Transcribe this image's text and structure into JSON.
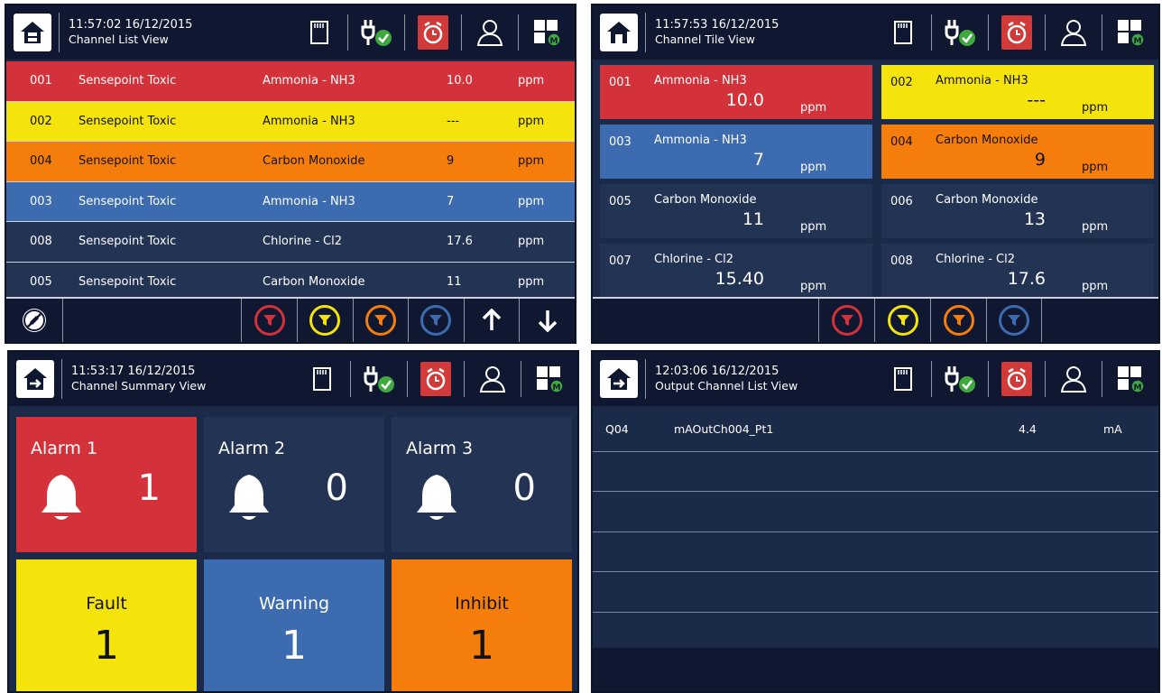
{
  "colors": {
    "red": "#d4323a",
    "yellow": "#f4e40c",
    "orange": "#f57d0c",
    "blue": "#3d6bb0",
    "navy": "#223353",
    "dark": "#0f1830"
  },
  "icons": [
    "home-icon",
    "sd-card-icon",
    "power-ok-icon",
    "alarm-clock-icon",
    "user-icon",
    "grid-menu-icon"
  ],
  "panel1": {
    "time": "11:57:02  16/12/2015",
    "view": "Channel List View",
    "rows": [
      {
        "id": "001",
        "name": "Sensepoint Toxic",
        "gas": "Ammonia - NH3",
        "value": "10.0",
        "unit": "ppm"
      },
      {
        "id": "002",
        "name": "Sensepoint Toxic",
        "gas": "Ammonia - NH3",
        "value": "---",
        "unit": "ppm"
      },
      {
        "id": "004",
        "name": "Sensepoint Toxic",
        "gas": "Carbon Monoxide",
        "value": "9",
        "unit": "ppm"
      },
      {
        "id": "003",
        "name": "Sensepoint Toxic",
        "gas": "Ammonia - NH3",
        "value": "7",
        "unit": "ppm"
      },
      {
        "id": "008",
        "name": "Sensepoint Toxic",
        "gas": "Chlorine - Cl2",
        "value": "17.6",
        "unit": "ppm"
      },
      {
        "id": "005",
        "name": "Sensepoint Toxic",
        "gas": "Carbon Monoxide",
        "value": "11",
        "unit": "ppm"
      }
    ]
  },
  "panel2": {
    "time": "11:57:53  16/12/2015",
    "view": "Channel Tile View",
    "tiles": [
      {
        "id": "001",
        "gas": "Ammonia - NH3",
        "value": "10.0",
        "unit": "ppm"
      },
      {
        "id": "002",
        "gas": "Ammonia - NH3",
        "value": "---",
        "unit": "ppm"
      },
      {
        "id": "003",
        "gas": "Ammonia - NH3",
        "value": "7",
        "unit": "ppm"
      },
      {
        "id": "004",
        "gas": "Carbon Monoxide",
        "value": "9",
        "unit": "ppm"
      },
      {
        "id": "005",
        "gas": "Carbon Monoxide",
        "value": "11",
        "unit": "ppm"
      },
      {
        "id": "006",
        "gas": "Carbon Monoxide",
        "value": "13",
        "unit": "ppm"
      },
      {
        "id": "007",
        "gas": "Chlorine - Cl2",
        "value": "15.40",
        "unit": "ppm"
      },
      {
        "id": "008",
        "gas": "Chlorine - Cl2",
        "value": "17.6",
        "unit": "ppm"
      }
    ]
  },
  "panel3": {
    "time": "11:53:17  16/12/2015",
    "view": "Channel Summary View",
    "alarms": [
      {
        "label": "Alarm 1",
        "count": "1"
      },
      {
        "label": "Alarm 2",
        "count": "0"
      },
      {
        "label": "Alarm 3",
        "count": "0"
      }
    ],
    "states": [
      {
        "label": "Fault",
        "count": "1"
      },
      {
        "label": "Warning",
        "count": "1"
      },
      {
        "label": "Inhibit",
        "count": "1"
      }
    ]
  },
  "panel4": {
    "time": "12:03:06  16/12/2015",
    "view": "Output Channel List View",
    "rows": [
      {
        "id": "Q04",
        "name": "mAOutCh004_Pt1",
        "value": "4.4",
        "unit": "mA"
      }
    ]
  }
}
